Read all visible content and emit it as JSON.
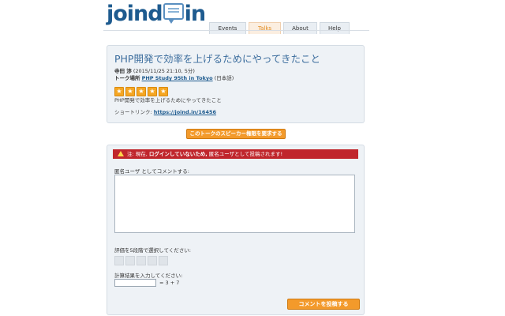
{
  "header": {
    "logo_left": "joind",
    "logo_right": "in",
    "nav": [
      "Events",
      "Talks",
      "About",
      "Help"
    ],
    "active_tab": "Talks"
  },
  "talk": {
    "title": "PHP開発で効率を上げるためにやってきたこと",
    "speaker": "寺田 渉",
    "datetime": "(2015/11/25 21:10, 5分)",
    "venue_label": "トーク場所",
    "event_name": "PHP Study 95th in Tokyo",
    "language": "(日本語)",
    "rating_stars": 5,
    "summary": "PHP開発で効率を上げるためにやってきたこと",
    "shortlink_label": "ショートリンク:",
    "shortlink_url": "https://joind.in/16456"
  },
  "claim_button": "このトークのスピーカー権限を要求する",
  "comment_form": {
    "alert_prefix": "注: 現在,",
    "alert_bold": "ログインしていないため,",
    "alert_suffix": "匿名ユーザとして投稿されます!",
    "comment_label": "匿名ユーザ としてコメントする:",
    "comment_value": "",
    "rating_label": "評価を5段階で選択してください:",
    "rating_value": 0,
    "calc_label": "計算結果を入力してください:",
    "calc_value": "",
    "calc_question": "= 3 + 7",
    "submit_label": "コメントを投稿する"
  },
  "colors": {
    "brand": "#1e5b8f",
    "accent": "#f39a2b",
    "alert": "#c0262c",
    "panel": "#eef2f6"
  }
}
